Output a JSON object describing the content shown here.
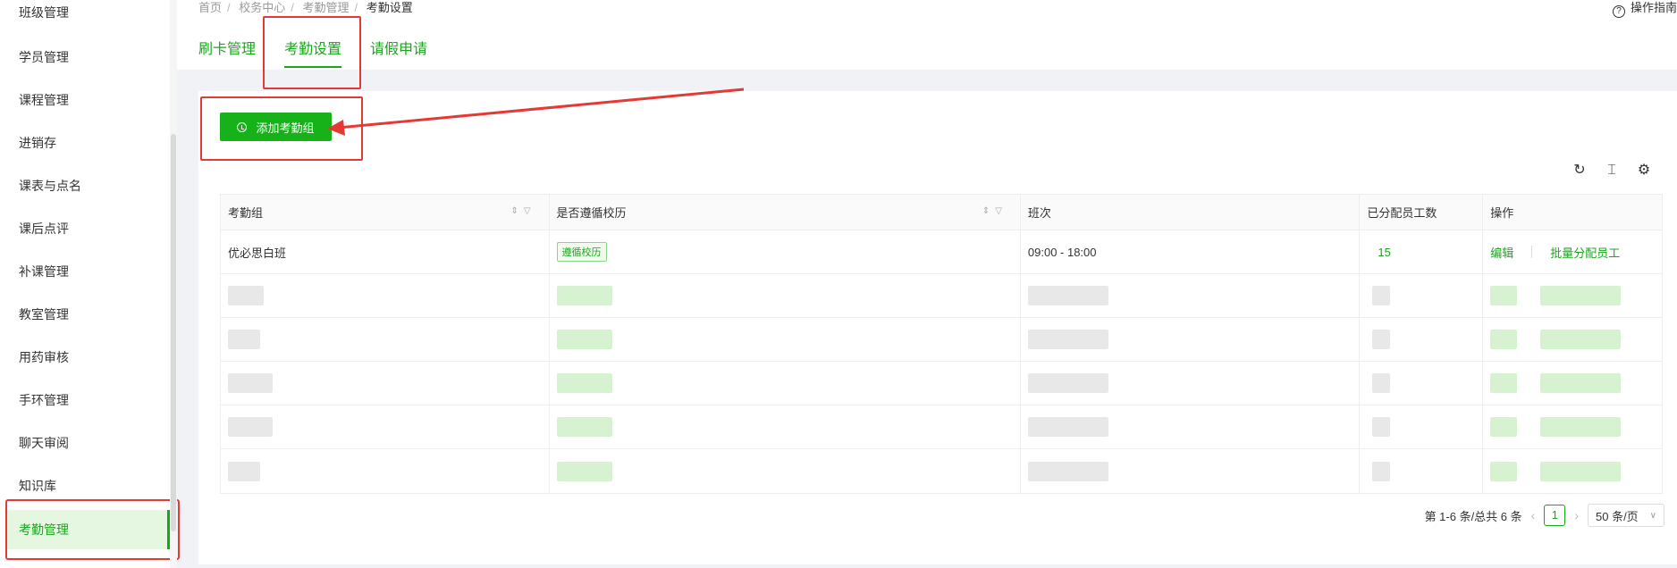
{
  "sidebar": {
    "items": [
      {
        "label": "班级管理"
      },
      {
        "label": "学员管理"
      },
      {
        "label": "课程管理"
      },
      {
        "label": "进销存"
      },
      {
        "label": "课表与点名"
      },
      {
        "label": "课后点评"
      },
      {
        "label": "补课管理"
      },
      {
        "label": "教室管理"
      },
      {
        "label": "用药审核"
      },
      {
        "label": "手环管理"
      },
      {
        "label": "聊天审阅"
      },
      {
        "label": "知识库"
      },
      {
        "label": "考勤管理"
      }
    ]
  },
  "breadcrumb": [
    "首页",
    "校务中心",
    "考勤管理",
    "考勤设置"
  ],
  "help": {
    "label": "操作指南"
  },
  "tabs": [
    {
      "label": "刷卡管理"
    },
    {
      "label": "考勤设置"
    },
    {
      "label": "请假申请"
    }
  ],
  "toolbar": {
    "add_label": "添加考勤组"
  },
  "table": {
    "headers": [
      "考勤组",
      "是否遵循校历",
      "班次",
      "已分配员工数",
      "操作"
    ],
    "rows": [
      {
        "group": "优必思白班",
        "calendar": "遵循校历",
        "shift": "09:00 - 18:00",
        "count": "15",
        "edit": "编辑",
        "assign": "批量分配员工"
      }
    ]
  },
  "pagination": {
    "summary": "第 1-6 条/总共 6 条",
    "current": "1",
    "page_size": "50 条/页"
  },
  "colors": {
    "accent": "#17a81a",
    "highlight": "#e53935"
  }
}
